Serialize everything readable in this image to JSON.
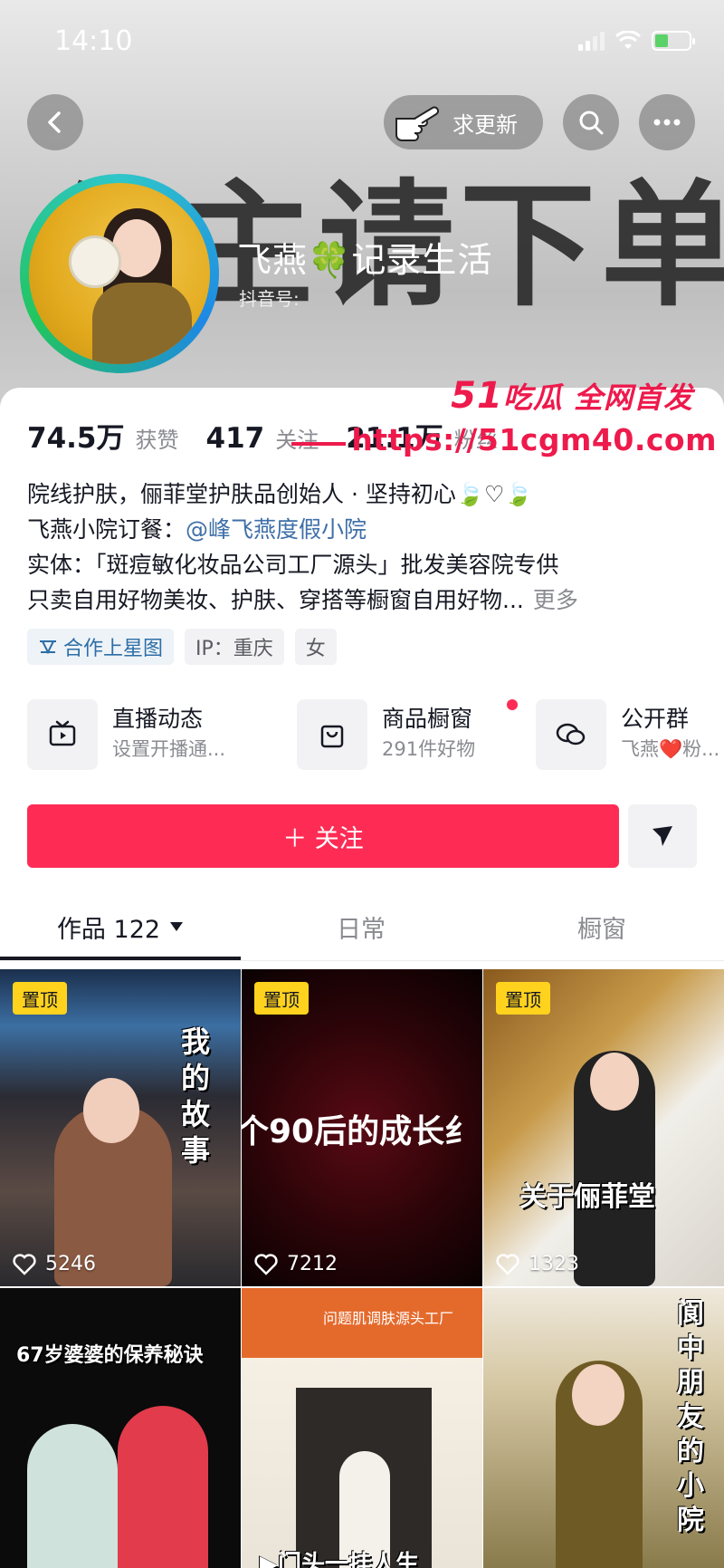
{
  "status_bar": {
    "time": "14:10"
  },
  "header": {
    "banner_text": "公主请下单",
    "update_label": "求更新",
    "nickname": "飞燕🍀记录生活",
    "douyin_id_label": "抖音号:"
  },
  "stats": [
    {
      "value": "74.5万",
      "label": "获赞"
    },
    {
      "value": "417",
      "label": "关注"
    },
    {
      "value": "21.1万",
      "label": "粉丝"
    }
  ],
  "watermark": {
    "line1_num": "51",
    "line1_text": "吃瓜 全网首发",
    "line2": "https://51cgm40.com"
  },
  "bio": {
    "line1": "院线护肤，俪菲堂护肤品创始人 · 坚持初心🍃♡🍃",
    "line2_prefix": "飞燕小院订餐：",
    "line2_mention": "@峰飞燕度假小院",
    "line3": "实体：「斑痘敏化妆品公司工厂源头」批发美容院专供",
    "line4": "只卖自用好物美妆、护肤、穿搭等橱窗自用好物...",
    "more": "更多"
  },
  "tags": [
    {
      "label": "合作上星图",
      "icon": "star-map-icon"
    },
    {
      "label": "IP：重庆"
    },
    {
      "label": "女"
    }
  ],
  "services": [
    {
      "title": "直播动态",
      "subtitle": "设置开播通...",
      "icon": "tv-icon"
    },
    {
      "title": "商品橱窗",
      "subtitle": "291件好物",
      "icon": "shopping-bag-icon"
    },
    {
      "title": "公开群",
      "subtitle": "飞燕❤️粉...",
      "icon": "chat-bubble-icon"
    }
  ],
  "actions": {
    "follow_label": "＋ 关注"
  },
  "tabs": [
    {
      "label": "作品 122",
      "active": true
    },
    {
      "label": "日常",
      "active": false
    },
    {
      "label": "橱窗",
      "active": false
    }
  ],
  "videos": [
    {
      "pinned": true,
      "pin_label": "置顶",
      "likes": "5246",
      "overlay": "我的故事",
      "bg": "car"
    },
    {
      "pinned": true,
      "pin_label": "置顶",
      "likes": "7212",
      "overlay": "个90后的成长纟",
      "bg": "dark"
    },
    {
      "pinned": true,
      "pin_label": "置顶",
      "likes": "1323",
      "overlay": "关于俪菲堂",
      "bg": "office"
    },
    {
      "pinned": false,
      "likes": "",
      "overlay": "67岁婆婆的保养秘诀",
      "bg": "black"
    },
    {
      "pinned": false,
      "likes": "",
      "overlay": "▶门头一挂人生",
      "top_sign": "问题肌调肤源头工厂",
      "bg": "storefront"
    },
    {
      "pinned": false,
      "likes": "",
      "overlay": "阆中朋友的小院",
      "bg": "yard"
    }
  ],
  "colors": {
    "accent": "#fe2c55",
    "mention": "#3f6fa8",
    "pin": "#ffd21e"
  }
}
